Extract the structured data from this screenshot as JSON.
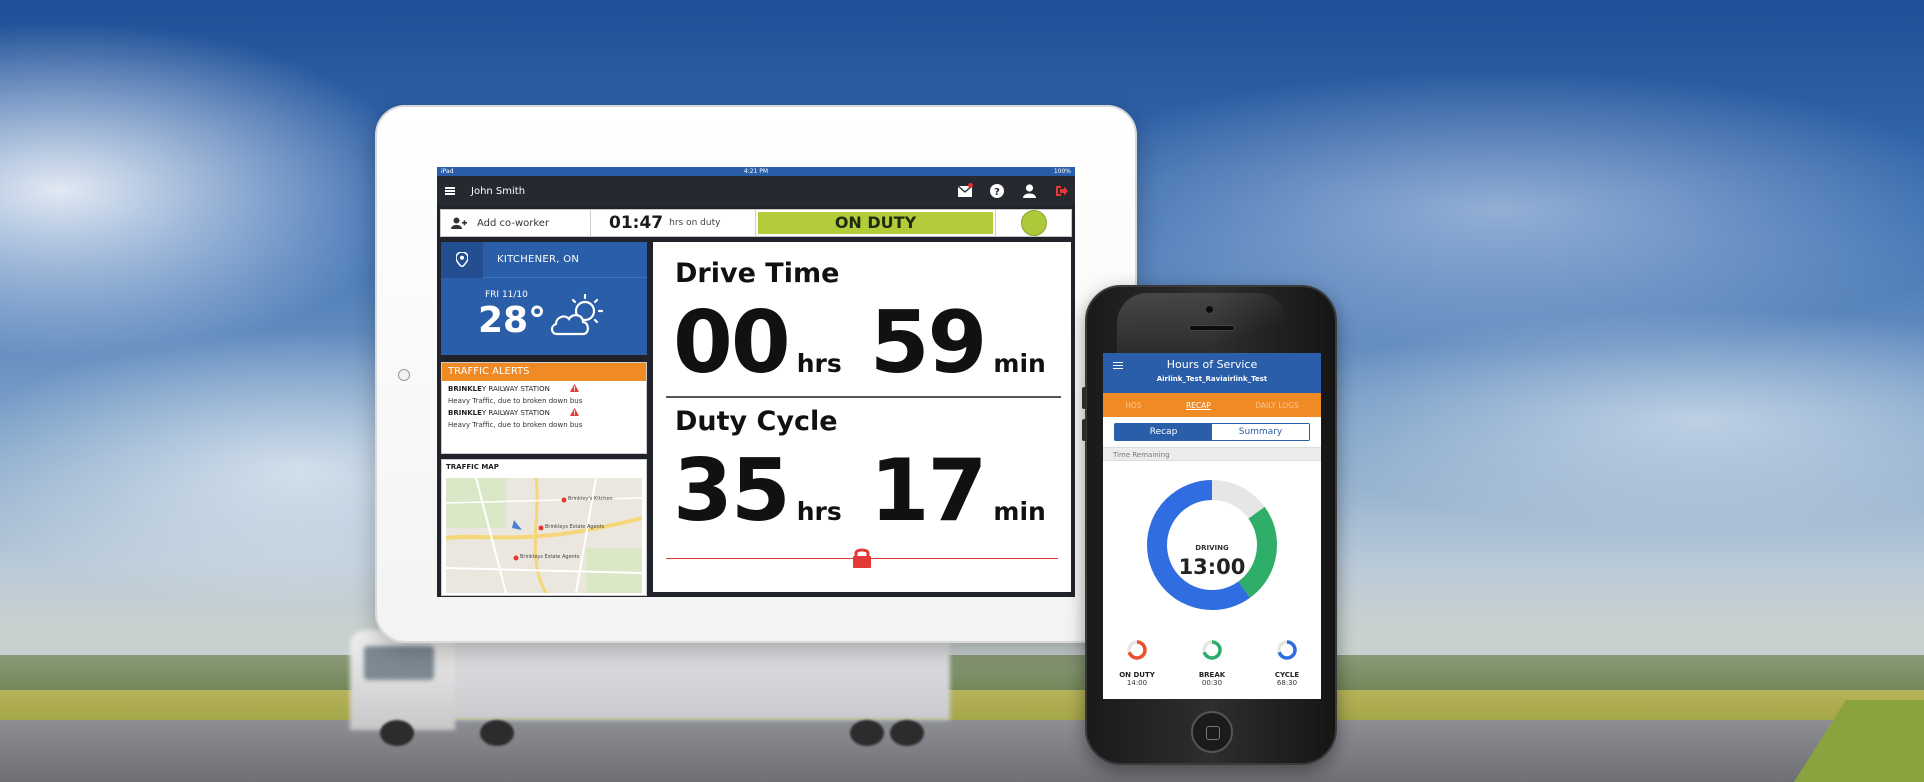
{
  "tablet": {
    "status_bar": {
      "carrier": "iPad",
      "time": "4:21 PM",
      "battery": "100%"
    },
    "nav": {
      "user_name": "John Smith"
    },
    "toolbar": {
      "add_coworker_label": "Add co-worker",
      "hours_on_duty_value": "01:47",
      "hours_on_duty_label": "hrs on duty",
      "status_label": "ON DUTY"
    },
    "weather": {
      "location": "KITCHENER, ON",
      "date": "FRI 11/10",
      "temperature": "28°"
    },
    "traffic": {
      "title": "TRAFFIC ALERTS",
      "alerts": [
        {
          "station_bold": "BRINKLE",
          "station_rest": "Y RAILWAY STATION",
          "description": "Heavy Traffic, due to broken down bus"
        },
        {
          "station_bold": "BRINKLE",
          "station_rest": "Y RAILWAY STATION",
          "description": "Heavy Traffic, due to broken down bus"
        }
      ],
      "map_title": "TRAFFIC MAP",
      "map_labels": [
        "Brinkley's Kitchen",
        "Brinkleys Estate Agents",
        "Brinkleys Estate Agents"
      ]
    },
    "drive_time": {
      "label": "Drive Time",
      "hours": "00",
      "hours_unit": "hrs",
      "minutes": "59",
      "minutes_unit": "min"
    },
    "duty_cycle": {
      "label": "Duty Cycle",
      "hours": "35",
      "hours_unit": "hrs",
      "minutes": "17",
      "minutes_unit": "min"
    }
  },
  "phone": {
    "title": "Hours of Service",
    "subtitle": "Airlink_Test_Raviairlink_Test",
    "tabs": [
      {
        "label": "HOS",
        "active": false
      },
      {
        "label": "RECAP",
        "active": true
      },
      {
        "label": "DAILY LOGS",
        "active": false
      }
    ],
    "segments": {
      "recap": "Recap",
      "summary": "Summary"
    },
    "section_label": "Time Remaining",
    "donut": {
      "label": "DRIVING",
      "value": "13:00",
      "blue_fraction": 0.6,
      "green_fraction": 0.25
    },
    "minis": [
      {
        "label": "ON DUTY",
        "value": "14:00",
        "color": "#e8502f"
      },
      {
        "label": "BREAK",
        "value": "00:30",
        "color": "#2fae6a"
      },
      {
        "label": "CYCLE",
        "value": "68:30",
        "color": "#2f6de0"
      }
    ]
  },
  "colors": {
    "brand_blue": "#2b5ea8",
    "accent_orange": "#f08a24",
    "duty_green": "#b4cc3a",
    "alert_red": "#e23a36"
  }
}
